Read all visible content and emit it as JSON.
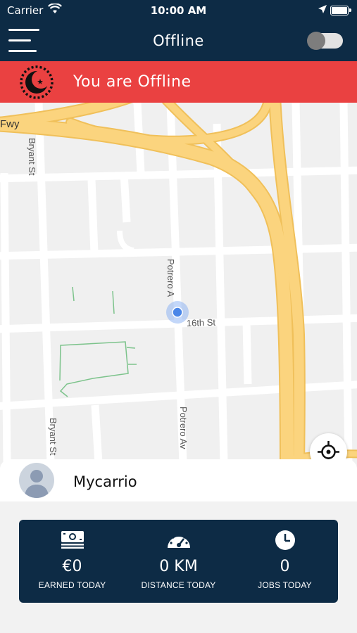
{
  "status_bar": {
    "carrier": "Carrier",
    "time": "10:00 AM"
  },
  "nav": {
    "title": "Offline",
    "menu_icon": "hamburger-menu-icon",
    "online_toggle": false
  },
  "banner": {
    "text": "You are Offline",
    "icon": "moon-icon",
    "color": "#ea4141"
  },
  "map": {
    "labels": {
      "fwy": "Fwy",
      "bryant_top": "Bryant St",
      "bryant_bottom": "Bryant St",
      "potrero_top": "Potrero A",
      "potrero_bottom": "Potrero Av",
      "sixteenth": "16th St"
    },
    "recenter_icon": "crosshair-icon"
  },
  "profile": {
    "name": "Mycarrio",
    "avatar_icon": "user-avatar-icon"
  },
  "stats": [
    {
      "icon": "money-icon",
      "value": "€0",
      "label": "EARNED TODAY"
    },
    {
      "icon": "speedometer-icon",
      "value": "0 KM",
      "label": "DISTANCE TODAY"
    },
    {
      "icon": "clock-icon",
      "value": "0",
      "label": "JOBS TODAY"
    }
  ],
  "colors": {
    "navy": "#0d2b45",
    "offline_red": "#ea4141",
    "road_yellow": "#fbd47e"
  }
}
